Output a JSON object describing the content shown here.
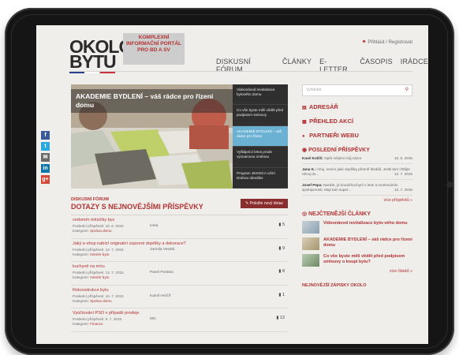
{
  "header": {
    "logo_line1": "OKOLO",
    "logo_line2": "BYTU",
    "tag_line1": "KOMPLEXNÍ",
    "tag_line2": "INFORMAČNÍ PORTÁL",
    "tag_line3": "PRO BD A SV",
    "login": "Přihlásit / Registrovat",
    "nav": [
      "DISKUSNÍ FÓRUM",
      "ČLÁNKY",
      "E-LETTER",
      "ČASOPIS",
      "IRÁDCE"
    ]
  },
  "social": [
    {
      "label": "f",
      "color": "#3b5998"
    },
    {
      "label": "t",
      "color": "#2aa9e0"
    },
    {
      "label": "✉",
      "color": "#6a6a6a"
    },
    {
      "label": "in",
      "color": "#0e76a8"
    },
    {
      "label": "g+",
      "color": "#d34836"
    }
  ],
  "hero": {
    "title": "AKADEMIE BYDLENÍ – váš rádce pro řízení domu",
    "side_items": [
      "Videonávod revitalizace bytového domu",
      "Co vše byste měli vědět před podpisem smlouvy",
      "AKADEMIE BYDLENÍ – váš rádce pro řízení",
      "Vyšlápnící letos prode významnou změnou",
      "Program JESSICA učiní Drahou obnoliko"
    ]
  },
  "forum": {
    "kicker": "DISKUSNÍ FÓRUM",
    "title": "DOTAZY S NEJNOVĚJŠÍMI PŘÍSPĚVKY",
    "button": "Položte nový dotaz",
    "rows": [
      {
        "title": "vodoměr měsíčky bys",
        "date": "Poslední příspěvek: 10. 6. 2015",
        "category": "Správa domu",
        "author": "Ivetа",
        "count": "5"
      },
      {
        "title": "Jaký e-shop nabízí originální úsporné dopňlky a dekorace?",
        "date": "Poslední příspěvek: 13. 7. 2015",
        "category": "Interiér bytu",
        "author": "Jarmila Veselá",
        "count": "9"
      },
      {
        "title": "kuchyně na míru",
        "date": "Poslední příspěvek: 13. 7. 2015",
        "category": "Interiér bytu",
        "author": "Pavel Postrao",
        "count": "8"
      },
      {
        "title": "Rekonstrukce bytu",
        "date": "Poslední příspěvek: 10. 7. 2015",
        "category": "Správa domu",
        "author": "Kamil Hrnčíř",
        "count": "1"
      },
      {
        "title": "Vyúčtování PSO v případě prodeje",
        "date": "Poslední příspěvek: 9. 7. 2015",
        "category": "Finance",
        "author": "MG",
        "count": "13"
      }
    ],
    "category_prefix": "Kategorie:"
  },
  "sidebar": {
    "search_placeholder": "Vyhledat",
    "links": [
      "ADRESÁŘ",
      "PŘEHLED AKCÍ",
      "PARTNEŘI WEBU"
    ],
    "posts_title": "POSLEDNÍ PŘÍSPĚVKY",
    "posts": [
      {
        "author": "Karel Kolšš:",
        "text": "Opět mějsmi můj názor",
        "date": "10. 6. 2015"
      },
      {
        "author": "Jana K.:",
        "text": "Ahoj, nevím jaké doplňky přesně hledáš. Jestli tam chtějte něcoj do...",
        "date": "13. 7. 2015"
      },
      {
        "author": "Josef Pepa:",
        "text": "Nankle, já kouall kuchyní v lese a montováním spokojenosti. Mají tam super...",
        "date": "13. 7. 2015"
      }
    ],
    "more_posts": "více příspěvků »",
    "articles_title": "NEJČTENĚJŠÍ ČLÁNKY",
    "articles": [
      {
        "title": "Videonávod revitalizace byto-vého domu",
        "thumb_color": "#8aa0b0"
      },
      {
        "title": "AKADEMIE BYDLENÍ – váš rádce pro řízení domu",
        "thumb_color": "#a5956f"
      },
      {
        "title": "Co vše byste měli vědět před podpisem smlouvy o koupi bytu?",
        "thumb_color": "#6f8a66"
      }
    ],
    "more_articles": "více článků »",
    "bottom_label": "NEJNOVĚJŠÍ ZÁPISKY OKOLO"
  }
}
